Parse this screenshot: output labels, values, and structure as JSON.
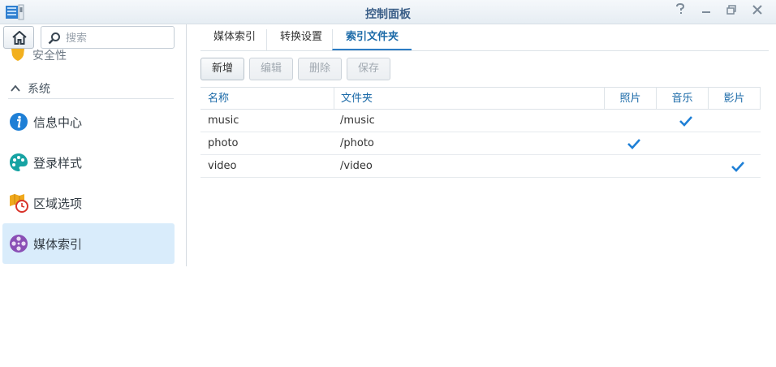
{
  "window": {
    "title": "控制面板",
    "buttons": [
      "help-icon",
      "minimize-icon",
      "restore-icon",
      "close-icon"
    ]
  },
  "sidebar": {
    "search_placeholder": "搜索",
    "partial_item_label": "安全性",
    "section_label": "系统",
    "items": [
      {
        "label": "信息中心",
        "icon": "info-icon",
        "active": false
      },
      {
        "label": "登录样式",
        "icon": "palette-icon",
        "active": false
      },
      {
        "label": "区域选项",
        "icon": "region-clock-icon",
        "active": false
      },
      {
        "label": "媒体索引",
        "icon": "film-reel-icon",
        "active": true
      }
    ]
  },
  "tabs": [
    {
      "label": "媒体索引",
      "active": false
    },
    {
      "label": "转换设置",
      "active": false
    },
    {
      "label": "索引文件夹",
      "active": true
    }
  ],
  "toolbar": {
    "add_label": "新增",
    "edit_label": "编辑",
    "delete_label": "删除",
    "save_label": "保存"
  },
  "table": {
    "columns": [
      "名称",
      "文件夹",
      "照片",
      "音乐",
      "影片"
    ],
    "rows": [
      {
        "name": "music",
        "folder": "/music",
        "photo": false,
        "music": true,
        "video": false
      },
      {
        "name": "photo",
        "folder": "/photo",
        "photo": true,
        "music": false,
        "video": false
      },
      {
        "name": "video",
        "folder": "/video",
        "photo": false,
        "music": false,
        "video": true
      }
    ]
  },
  "colors": {
    "accent": "#2b7cc4",
    "active_item_bg": "#d9ecfb",
    "header_text": "#1b6aa8"
  }
}
